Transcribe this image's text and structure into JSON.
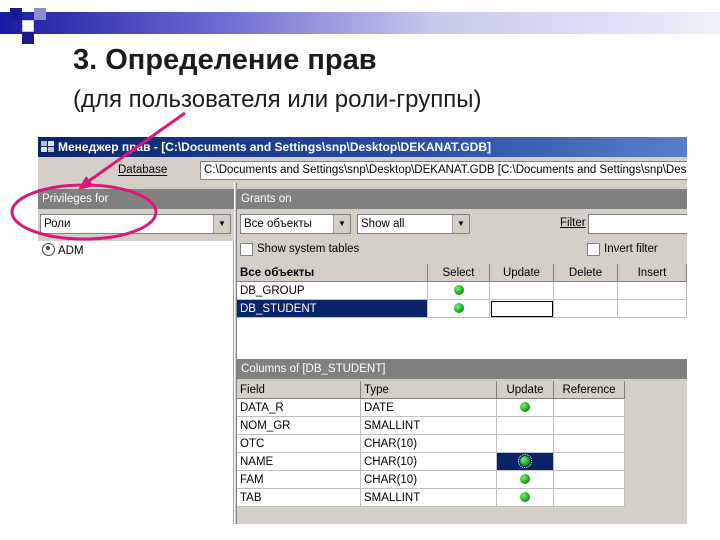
{
  "slide": {
    "title": "3. Определение прав",
    "subtitle": "(для пользователя или роли-группы)"
  },
  "window": {
    "title": "Менеджер прав - [C:\\Documents and Settings\\snp\\Desktop\\DEKANAT.GDB]"
  },
  "database": {
    "label": "Database",
    "value": "C:\\Documents and Settings\\snp\\Desktop\\DEKANAT.GDB [C:\\Documents and Settings\\snp\\Desktop\\"
  },
  "privileges_panel": {
    "header": "Privileges for",
    "combo_value": "Роли",
    "items": [
      {
        "label": "ADM",
        "icon": "user-icon"
      }
    ]
  },
  "grants_panel": {
    "header": "Grants on",
    "objects_combo": "Все объекты",
    "show_combo": "Show all",
    "filter_label": "Filter",
    "filter_value": "",
    "show_system_tables_label": "Show system tables",
    "show_system_tables_checked": false,
    "invert_filter_label": "Invert filter",
    "invert_filter_checked": false
  },
  "objects_grid": {
    "columns": [
      "Все объекты",
      "Select",
      "Update",
      "Delete",
      "Insert"
    ],
    "rows": [
      {
        "name": "DB_GROUP",
        "select": true,
        "update": false,
        "delete": false,
        "insert": false,
        "selected": false
      },
      {
        "name": "DB_STUDENT",
        "select": true,
        "update": false,
        "delete": false,
        "insert": false,
        "selected": true
      }
    ]
  },
  "columns_panel": {
    "header": "Columns of [DB_STUDENT]",
    "columns": [
      "Field",
      "Type",
      "Update",
      "Reference"
    ],
    "rows": [
      {
        "field": "DATA_R",
        "type": "DATE",
        "update": true,
        "reference": false
      },
      {
        "field": "NOM_GR",
        "type": "SMALLINT",
        "update": false,
        "reference": false
      },
      {
        "field": "OTC",
        "type": "CHAR(10)",
        "update": false,
        "reference": false
      },
      {
        "field": "NAME",
        "type": "CHAR(10)",
        "update": true,
        "reference": false,
        "cursor": true
      },
      {
        "field": "FAM",
        "type": "CHAR(10)",
        "update": true,
        "reference": false
      },
      {
        "field": "TAB",
        "type": "SMALLINT",
        "update": true,
        "reference": false
      }
    ]
  },
  "colors": {
    "accent": "#0a246a",
    "grant_on": "#1aa51a",
    "annotation": "#d8197a",
    "slide_decor": "#1a1a8c"
  }
}
